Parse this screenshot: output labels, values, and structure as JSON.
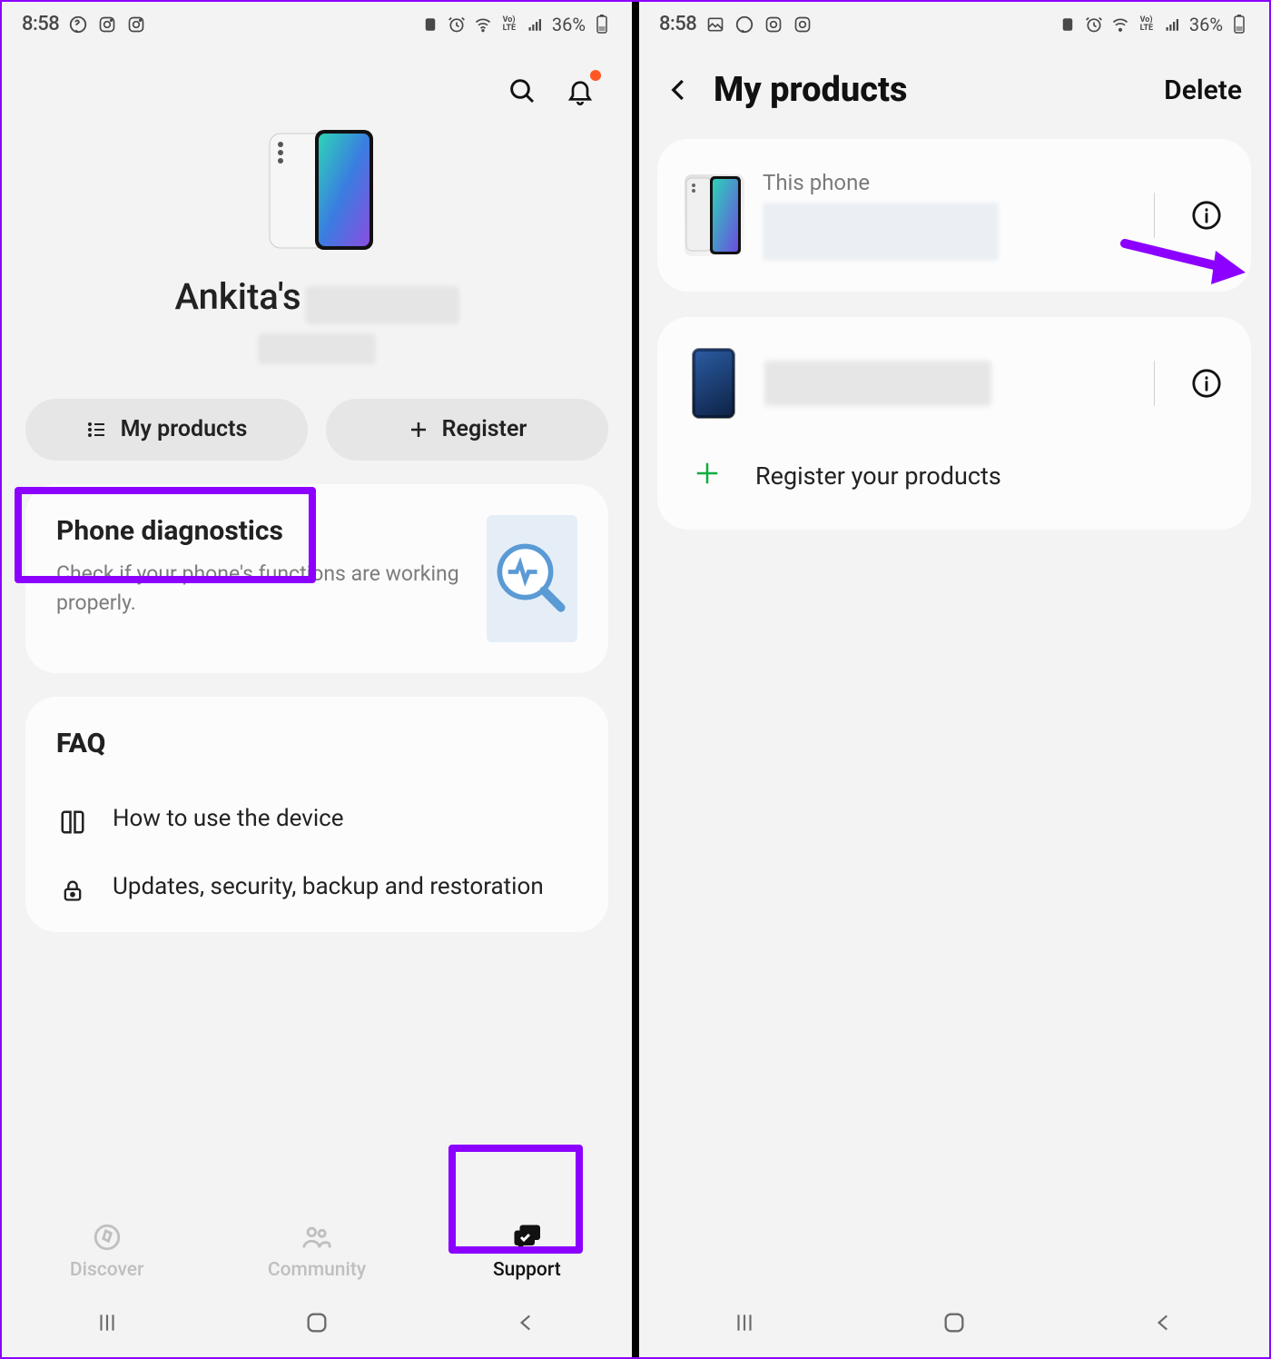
{
  "status": {
    "time": "8:58",
    "battery_pct": "36%"
  },
  "screen1": {
    "owner_prefix": "Ankita's",
    "buttons": {
      "my_products": "My products",
      "register": "Register"
    },
    "diagnostics": {
      "title": "Phone diagnostics",
      "subtitle": "Check if your phone's functions are working properly."
    },
    "faq": {
      "title": "FAQ",
      "items": [
        "How to use the device",
        "Updates, security, backup and restoration"
      ]
    },
    "nav": {
      "discover": "Discover",
      "community": "Community",
      "support": "Support"
    }
  },
  "screen2": {
    "title": "My products",
    "delete": "Delete",
    "this_phone_label": "This phone",
    "register_products": "Register your products"
  }
}
